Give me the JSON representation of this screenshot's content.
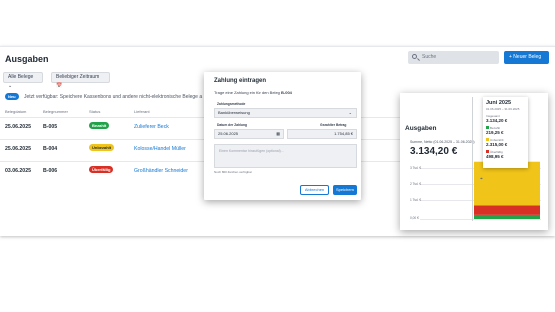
{
  "app": {
    "title": "Ausgaben",
    "search_placeholder": "Suche",
    "new_button": "+ Neuer Beleg"
  },
  "filters": {
    "all_receipts": "Alle Belege ⌄",
    "period": "Beliebiger Zeitraum 📅"
  },
  "notice": {
    "badge": "Neu",
    "text": "Jetzt verfügbar: Speichere Kassenbons und andere nicht-elektronische Belege a"
  },
  "table": {
    "headers": [
      "Belegdatum",
      "Belegnummer",
      "Status",
      "Lieferant"
    ],
    "rows": [
      {
        "date": "25.06.2025",
        "number": "B-005",
        "status": "Bezahlt",
        "status_kind": "paid",
        "supplier": "Zulieferer Beck"
      },
      {
        "date": "25.06.2025",
        "number": "B-004",
        "status": "Unbezahlt",
        "status_kind": "part",
        "supplier": "Kolosse/Handel Müller"
      },
      {
        "date": "03.06.2025",
        "number": "B-006",
        "status": "Überfällig",
        "status_kind": "over",
        "supplier": "Großhändler Schneider"
      }
    ]
  },
  "modal": {
    "title": "Zahlung eintragen",
    "intro_prefix": "Trage eine Zahlung ein für den Beleg ",
    "intro_ref": "B-004",
    "method_label": "Zahlungsmethode",
    "method_value": "Banküberweisung",
    "date_label": "Datum der Zahlung",
    "date_value": "25.06.2025",
    "amount_label": "Gezahlter Betrag",
    "amount_value": "1.754,85 €",
    "comment_placeholder": "Einen Kommentar hinzufügen (optional)...",
    "hint": "Noch 800 Zeichen verfügbar",
    "cancel": "Abbrechen",
    "save": "Speichern"
  },
  "chart_card": {
    "title": "Ausgaben",
    "summary": "Summe, Netto (01.06.2025 – 31.06.2025)",
    "total": "3.134,20 €",
    "y_ticks": [
      "3 Tsd. €",
      "2 Tsd. €",
      "1 Tsd. €",
      "0,00 €"
    ],
    "tooltip": {
      "month": "Juni 2025",
      "range": "01.06.2025 – 31.06.2025",
      "total_label": "Insgesamt",
      "total_value": "3.134,20 €",
      "items": [
        {
          "label": "Bezahlt",
          "value": "219,25 €",
          "color": "#22a34a"
        },
        {
          "label": "Unbezahlt",
          "value": "2.315,00 €",
          "color": "#f0c419"
        },
        {
          "label": "Überfällig",
          "value": "498,95 €",
          "color": "#d93025"
        }
      ]
    }
  },
  "chart_data": {
    "type": "bar",
    "categories": [
      "Juni 2025"
    ],
    "stacked": true,
    "series": [
      {
        "name": "Bezahlt",
        "values": [
          219.25
        ],
        "color": "#22a34a"
      },
      {
        "name": "Überfällig",
        "values": [
          498.95
        ],
        "color": "#d93025"
      },
      {
        "name": "Unbezahlt",
        "values": [
          2315.0
        ],
        "color": "#f0c419"
      }
    ],
    "ylim": [
      0,
      3000
    ],
    "title": "Ausgaben"
  }
}
